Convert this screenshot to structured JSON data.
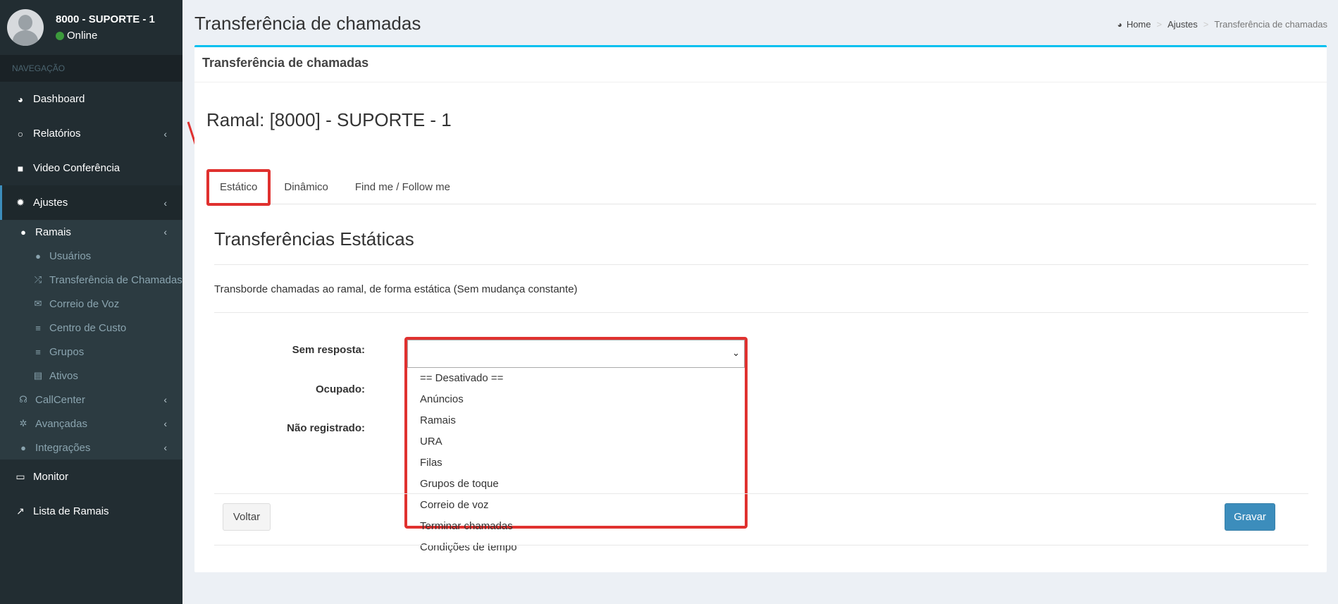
{
  "user": {
    "name": "8000 - SUPORTE - 1",
    "status": "Online"
  },
  "nav": {
    "header": "NAVEGAÇÃO",
    "dashboard": "Dashboard",
    "relatorios": "Relatórios",
    "video": "Video Conferência",
    "ajustes": "Ajustes",
    "ramais": "Ramais",
    "usuarios": "Usuários",
    "transferencia": "Transferência de Chamadas",
    "correio": "Correio de Voz",
    "centro": "Centro de Custo",
    "grupos": "Grupos",
    "ativos": "Ativos",
    "callcenter": "CallCenter",
    "avancadas": "Avançadas",
    "integracoes": "Integrações",
    "monitor": "Monitor",
    "lista": "Lista de Ramais"
  },
  "header": {
    "title": "Transferência de chamadas",
    "breadcrumb": {
      "home": "Home",
      "ajustes": "Ajustes",
      "current": "Transferência de chamadas"
    }
  },
  "box": {
    "title": "Transferência de chamadas",
    "ramal": "Ramal: [8000] - SUPORTE - 1",
    "tabs": [
      "Estático",
      "Dinâmico",
      "Find me / Follow me"
    ],
    "section_title": "Transferências Estáticas",
    "description": "Transborde chamadas ao ramal, de forma estática (Sem mudança constante)",
    "labels": {
      "sem_resposta": "Sem resposta:",
      "ocupado": "Ocupado:",
      "nao_registrado": "Não registrado:"
    },
    "select_value": "",
    "options": [
      "== Desativado ==",
      "Anúncios",
      "Ramais",
      "URA",
      "Filas",
      "Grupos de toque",
      "Correio de voz",
      "Terminar chamadas",
      "Condições de tempo"
    ],
    "buttons": {
      "voltar": "Voltar",
      "gravar": "Gravar"
    }
  },
  "colors": {
    "sidebar": "#222d32",
    "accent": "#3c8dbc",
    "highlight": "#e0312f",
    "box_top": "#00c0ef"
  }
}
